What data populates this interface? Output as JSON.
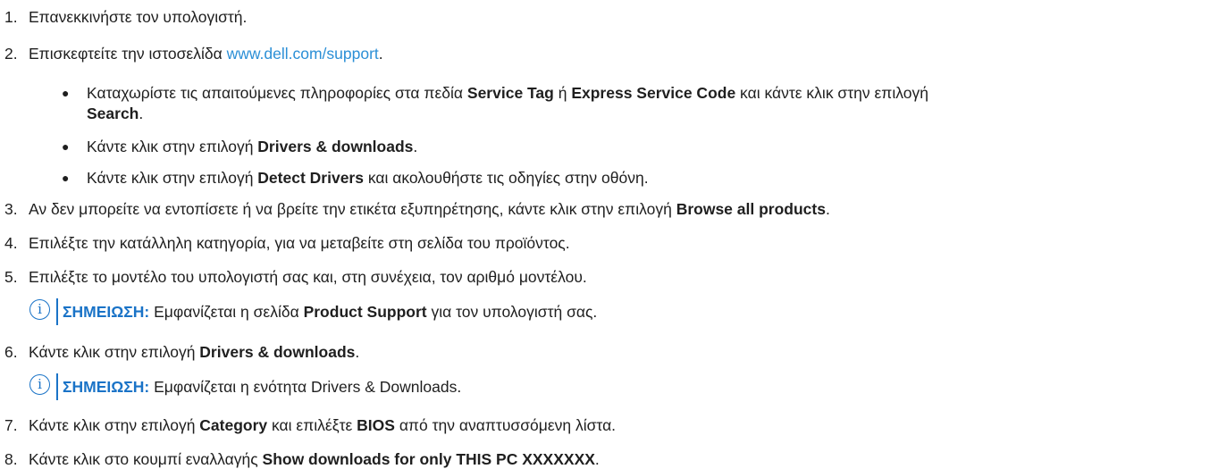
{
  "steps": {
    "s1": {
      "num": "1.",
      "text": "Επανεκκινήστε τον υπολογιστή."
    },
    "s2": {
      "num": "2.",
      "pre": "Επισκεφτείτε την ιστοσελίδα ",
      "link": "www.dell.com/support",
      "post": "."
    },
    "b1": {
      "pre": "Καταχωρίστε τις απαιτούμενες πληροφορίες στα πεδία ",
      "b1": "Service Tag",
      "mid1": " ή ",
      "b2": "Express Service Code",
      "mid2": " και κάντε κλικ στην επιλογή",
      "b3": "Search",
      "post": "."
    },
    "b2": {
      "pre": "Κάντε κλικ στην επιλογή ",
      "b": "Drivers & downloads",
      "post": "."
    },
    "b3": {
      "pre": "Κάντε κλικ στην επιλογή ",
      "b": "Detect Drivers",
      "post": " και ακολουθήστε τις οδηγίες στην οθόνη."
    },
    "s3": {
      "num": "3.",
      "pre": "Αν δεν μπορείτε να εντοπίσετε ή να βρείτε την ετικέτα εξυπηρέτησης, κάντε κλικ στην επιλογή ",
      "b": "Browse all products",
      "post": "."
    },
    "s4": {
      "num": "4.",
      "text": "Επιλέξτε την κατάλληλη κατηγορία, για να μεταβείτε στη σελίδα του προϊόντος."
    },
    "s5": {
      "num": "5.",
      "text": "Επιλέξτε το μοντέλο του υπολογιστή σας και, στη συνέχεια, τον αριθμό μοντέλου."
    },
    "n1": {
      "label": "ΣΗΜΕΙΩΣΗ:",
      "pre": " Εμφανίζεται η σελίδα ",
      "b": "Product Support",
      "post": " για τον υπολογιστή σας."
    },
    "s6": {
      "num": "6.",
      "pre": "Κάντε κλικ στην επιλογή ",
      "b": "Drivers & downloads",
      "post": "."
    },
    "n2": {
      "label": "ΣΗΜΕΙΩΣΗ:",
      "text": " Εμφανίζεται η ενότητα Drivers & Downloads."
    },
    "s7": {
      "num": "7.",
      "pre": "Κάντε κλικ στην επιλογή ",
      "b1": "Category",
      "mid": " και επιλέξτε ",
      "b2": "BIOS",
      "post": " από την αναπτυσσόμενη λίστα."
    },
    "s8": {
      "num": "8.",
      "pre": "Κάντε κλικ στο κουμπί εναλλαγής ",
      "b": "Show downloads for only THIS PC XXXXXXX",
      "post": "."
    }
  },
  "note_icon": "info-icon",
  "colors": {
    "accent": "#1a73c7",
    "link": "#2b8fd6",
    "text": "#1f1f1f"
  }
}
